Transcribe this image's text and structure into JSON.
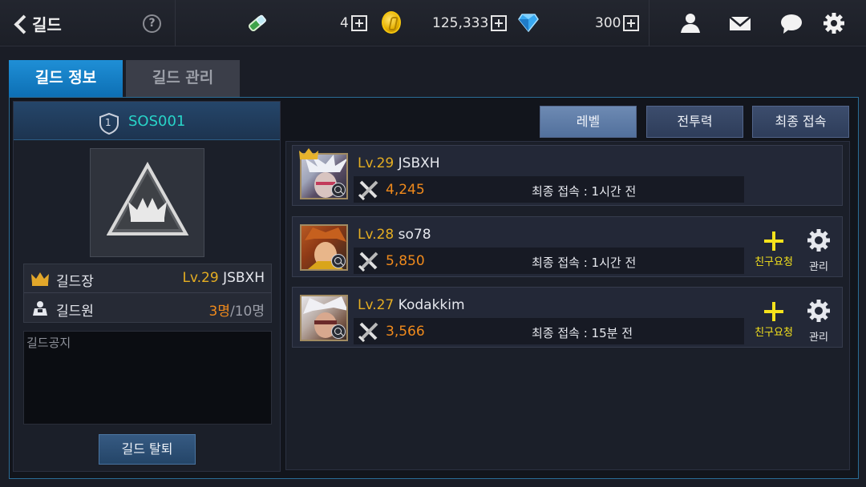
{
  "header": {
    "back_label": "길드",
    "help_label": "?",
    "stamina": "4",
    "gold": "125,333",
    "gems": "300",
    "icons": [
      "stamina-icon",
      "gold-coin-icon",
      "gem-icon",
      "friends-icon",
      "mail-icon",
      "chat-icon",
      "settings-gear-icon"
    ]
  },
  "tabs": [
    {
      "label": "길드 정보",
      "active": true
    },
    {
      "label": "길드 관리",
      "active": false
    }
  ],
  "guild": {
    "rank": "1",
    "name": "SOS001",
    "master_label": "길드장",
    "master_level": "Lv.29",
    "master_name": "JSBXH",
    "members_label": "길드원",
    "member_count": "3명",
    "member_max": "/10명",
    "notice_label": "길드공지",
    "leave_label": "길드 탈퇴"
  },
  "sort": {
    "level": "레벨",
    "power": "전투력",
    "last_login": "최종 접속"
  },
  "members": [
    {
      "level": "Lv.29",
      "name": "JSBXH",
      "power": "4,245",
      "last_login": "최종 접속 : 1시간 전",
      "is_master": true
    },
    {
      "level": "Lv.28",
      "name": "so78",
      "power": "5,850",
      "last_login": "최종 접속 : 1시간 전",
      "is_master": false,
      "friend_label": "친구요청",
      "manage_label": "관리"
    },
    {
      "level": "Lv.27",
      "name": "Kodakkim",
      "power": "3,566",
      "last_login": "최종 접속 : 15분 전",
      "is_master": false,
      "friend_label": "친구요청",
      "manage_label": "관리"
    }
  ],
  "colors": {
    "accent_blue": "#1f8fd6",
    "level_gold": "#e4ad22",
    "power_orange": "#f08a1c",
    "guild_name_teal": "#28d4c8",
    "friend_yellow": "#f5e21c"
  }
}
